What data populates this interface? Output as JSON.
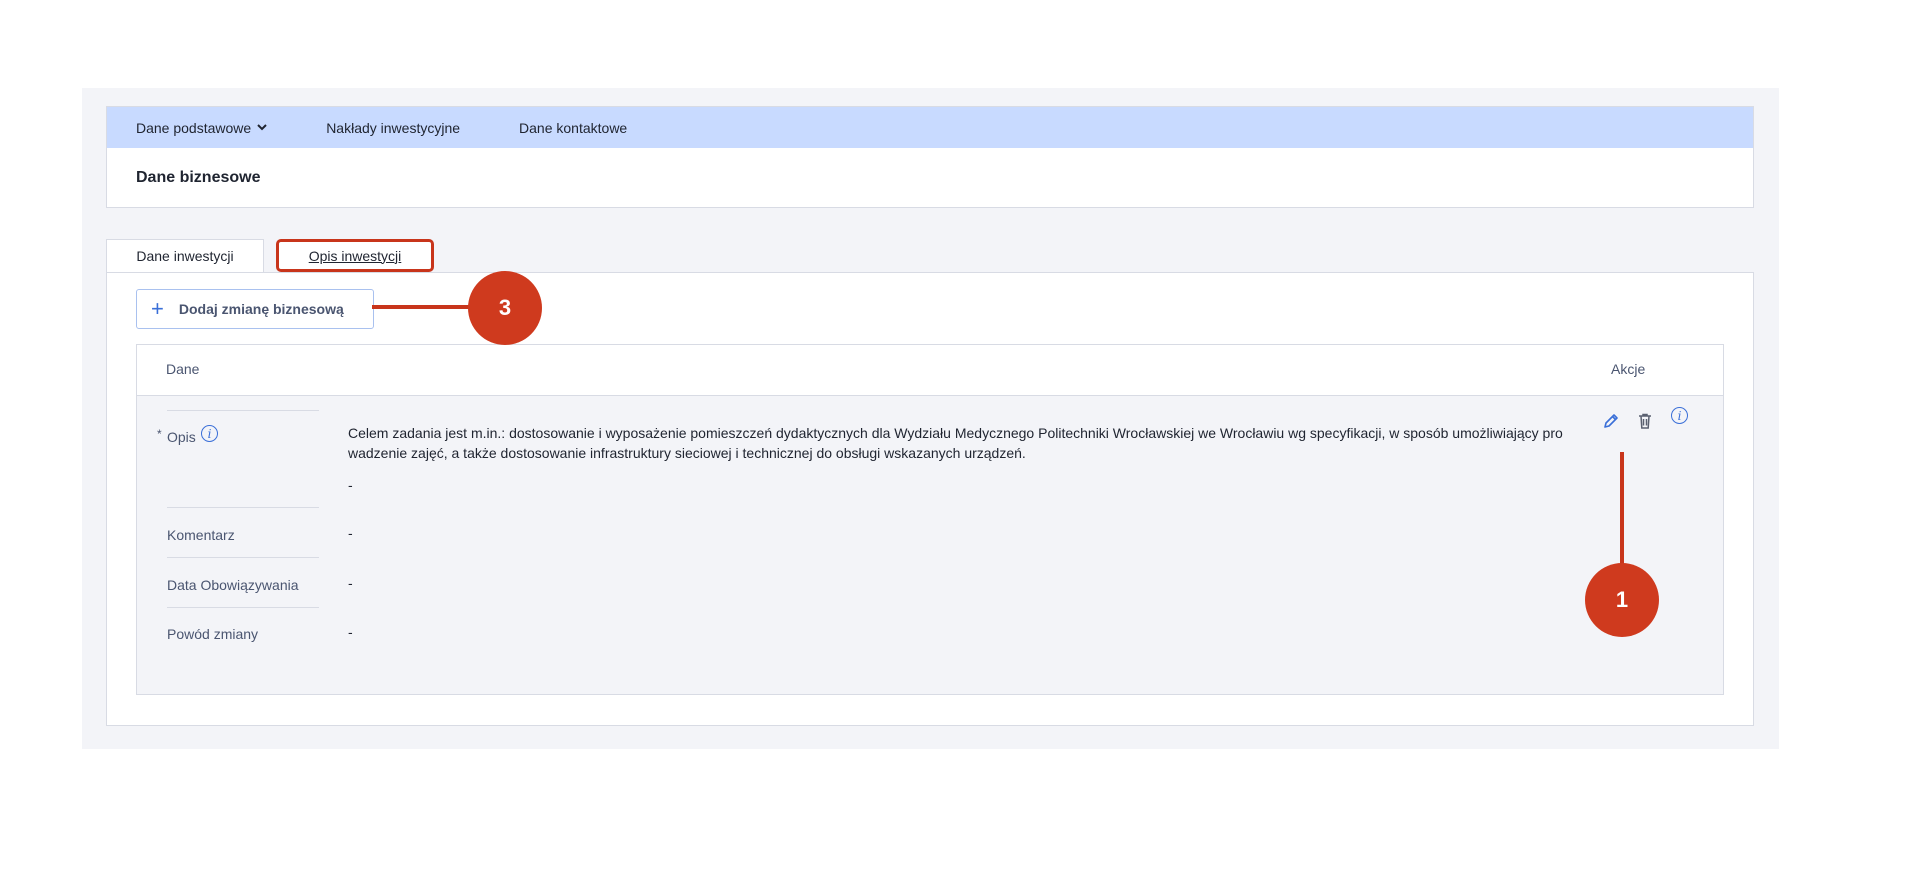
{
  "nav": {
    "items": [
      {
        "label": "Dane podstawowe",
        "has_dropdown": true
      },
      {
        "label": "Nakłady inwestycyjne"
      },
      {
        "label": "Dane kontaktowe"
      }
    ]
  },
  "card": {
    "title": "Dane biznesowe"
  },
  "tabs": {
    "items": [
      {
        "label": "Dane inwestycji"
      },
      {
        "label": "Opis inwestycji"
      }
    ]
  },
  "add_button": {
    "label": "Dodaj zmianę biznesową"
  },
  "table": {
    "headers": {
      "data": "Dane",
      "actions": "Akcje"
    },
    "rows": {
      "opis_label": "Opis",
      "required_mark": "*",
      "opis_value": "Celem zadania jest m.in.: dostosowanie i wyposażenie pomieszczeń dydaktycznych dla Wydziału Medycznego Politechniki Wrocławskiej we Wrocławiu wg specyfikacji, w sposób umożliwiający pro wadzenie zajęć, a także dostosowanie infrastruktury sieciowej i technicznej do obsługi wskazanych urządzeń.",
      "opis_extra": "-",
      "komentarz_label": "Komentarz",
      "komentarz_value": "-",
      "data_label": "Data Obowiązywania",
      "data_value": "-",
      "powod_label": "Powód zmiany",
      "powod_value": "-"
    }
  },
  "icons": {
    "info": "info-icon",
    "edit": "pencil-icon",
    "delete": "trash-icon",
    "chevron": "chevron-down-icon"
  },
  "callouts": {
    "badge_1": "1",
    "badge_3": "3"
  },
  "colors": {
    "nav_bg": "#c8daff",
    "accent": "#3a6fd8",
    "callout": "#cf3a1e"
  }
}
